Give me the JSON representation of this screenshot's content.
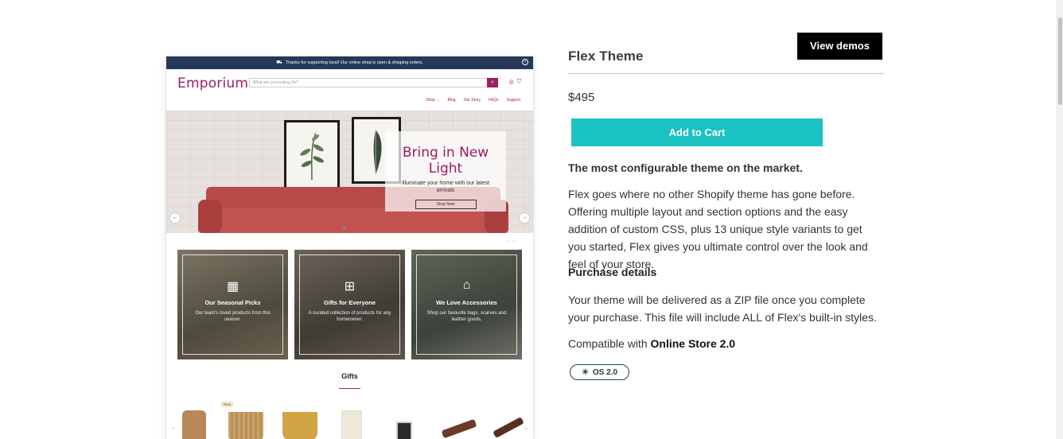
{
  "preview": {
    "announcement": "Thanks for supporting local! Our online shop is open & shipping orders.",
    "logo": "Emporium",
    "search_placeholder": "What are you looking for?",
    "nav": [
      "Shop",
      "Blog",
      "Our Story",
      "FAQs",
      "Support"
    ],
    "hero": {
      "title": "Bring in New Light",
      "subtitle": "Illuminate your home with our latest arrivals",
      "button": "Shop Now"
    },
    "cards": [
      {
        "title": "Our Seasonal Picks",
        "desc": "Our team's loved products from this season."
      },
      {
        "title": "Gifts for Everyone",
        "desc": "A curated collection of products for any homeowner."
      },
      {
        "title": "We Love Accessories",
        "desc": "Shop our favourite bags, scarves and leather goods."
      }
    ],
    "gifts_heading": "Gifts",
    "new_badge": "New"
  },
  "product": {
    "title": "Flex Theme",
    "view_demos": "View demos",
    "price": "$495",
    "add_to_cart": "Add to Cart",
    "tagline": "The most configurable theme on the market.",
    "description": "Flex goes where no other Shopify theme has gone before. Offering multiple layout and section options and the easy addition of custom CSS, plus 13 unique style variants to get you started, Flex gives you ultimate control over the look and feel of your store.",
    "details_heading": "Purchase details",
    "delivery": "Your theme will be delivered as a ZIP file once you complete your purchase. This file will include ALL of Flex's built-in styles.",
    "compat_prefix": "Compatible with ",
    "compat_value": "Online Store 2.0",
    "os_badge": "OS 2.0"
  },
  "colors": {
    "brand": "#9c1d61",
    "announce_bg": "#24395a",
    "cart_button": "#1ac2c1",
    "demos_button": "#000000"
  }
}
